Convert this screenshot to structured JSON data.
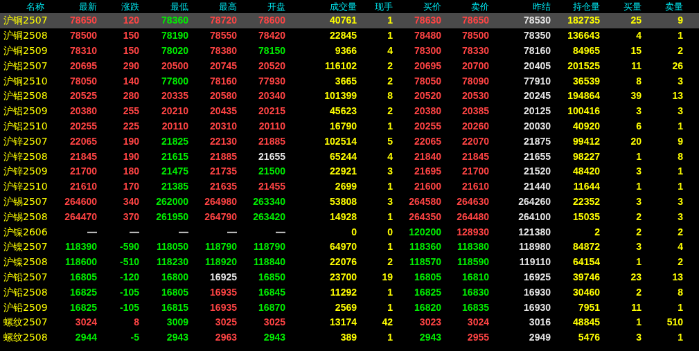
{
  "columns": [
    {
      "label": "名称",
      "kind": "name"
    },
    {
      "label": "最新",
      "kind": "price"
    },
    {
      "label": "涨跌",
      "kind": "change"
    },
    {
      "label": "最低",
      "kind": "price"
    },
    {
      "label": "最高",
      "kind": "price"
    },
    {
      "label": "开盘",
      "kind": "price"
    },
    {
      "label": "成交量",
      "kind": "qty"
    },
    {
      "label": "现手",
      "kind": "qty"
    },
    {
      "label": "买价",
      "kind": "price"
    },
    {
      "label": "卖价",
      "kind": "price"
    },
    {
      "label": "昨结",
      "kind": "prev"
    },
    {
      "label": "持仓量",
      "kind": "qty"
    },
    {
      "label": "买量",
      "kind": "qty"
    },
    {
      "label": "卖量",
      "kind": "qty"
    }
  ],
  "rows": [
    {
      "selected": true,
      "cells": [
        "沪铜2507",
        "78650",
        "120",
        "78360",
        "78720",
        "78600",
        "40761",
        "1",
        "78630",
        "78650",
        "78530",
        "182735",
        "25",
        "9"
      ]
    },
    {
      "selected": false,
      "cells": [
        "沪铜2508",
        "78500",
        "150",
        "78190",
        "78550",
        "78420",
        "22845",
        "1",
        "78480",
        "78500",
        "78350",
        "136643",
        "4",
        "1"
      ]
    },
    {
      "selected": false,
      "cells": [
        "沪铜2509",
        "78310",
        "150",
        "78020",
        "78380",
        "78150",
        "9366",
        "4",
        "78300",
        "78330",
        "78160",
        "84965",
        "15",
        "2"
      ]
    },
    {
      "selected": false,
      "cells": [
        "沪铝2507",
        "20695",
        "290",
        "20500",
        "20745",
        "20520",
        "116102",
        "2",
        "20695",
        "20700",
        "20405",
        "201525",
        "11",
        "26"
      ]
    },
    {
      "selected": false,
      "cells": [
        "沪铜2510",
        "78050",
        "140",
        "77800",
        "78160",
        "77930",
        "3665",
        "2",
        "78050",
        "78090",
        "77910",
        "36539",
        "8",
        "3"
      ]
    },
    {
      "selected": false,
      "cells": [
        "沪铝2508",
        "20525",
        "280",
        "20335",
        "20580",
        "20340",
        "101399",
        "8",
        "20520",
        "20530",
        "20245",
        "194864",
        "39",
        "13"
      ]
    },
    {
      "selected": false,
      "cells": [
        "沪铝2509",
        "20380",
        "255",
        "20210",
        "20435",
        "20215",
        "45623",
        "2",
        "20380",
        "20385",
        "20125",
        "100416",
        "3",
        "3"
      ]
    },
    {
      "selected": false,
      "cells": [
        "沪铝2510",
        "20255",
        "225",
        "20110",
        "20310",
        "20110",
        "16790",
        "1",
        "20255",
        "20260",
        "20030",
        "40920",
        "6",
        "1"
      ]
    },
    {
      "selected": false,
      "cells": [
        "沪锌2507",
        "22065",
        "190",
        "21825",
        "22130",
        "21885",
        "102514",
        "5",
        "22065",
        "22070",
        "21875",
        "99412",
        "20",
        "9"
      ]
    },
    {
      "selected": false,
      "cells": [
        "沪锌2508",
        "21845",
        "190",
        "21615",
        "21885",
        "21655",
        "65244",
        "4",
        "21840",
        "21845",
        "21655",
        "98227",
        "1",
        "8"
      ]
    },
    {
      "selected": false,
      "cells": [
        "沪锌2509",
        "21700",
        "180",
        "21475",
        "21735",
        "21500",
        "22921",
        "3",
        "21695",
        "21700",
        "21520",
        "48420",
        "3",
        "1"
      ]
    },
    {
      "selected": false,
      "cells": [
        "沪锌2510",
        "21610",
        "170",
        "21385",
        "21635",
        "21455",
        "2699",
        "1",
        "21600",
        "21610",
        "21440",
        "11644",
        "1",
        "1"
      ]
    },
    {
      "selected": false,
      "cells": [
        "沪锡2507",
        "264600",
        "340",
        "262000",
        "264980",
        "263340",
        "53808",
        "3",
        "264580",
        "264630",
        "264260",
        "22352",
        "3",
        "3"
      ]
    },
    {
      "selected": false,
      "cells": [
        "沪锡2508",
        "264470",
        "370",
        "261950",
        "264790",
        "263420",
        "14928",
        "1",
        "264350",
        "264480",
        "264100",
        "15035",
        "2",
        "3"
      ]
    },
    {
      "selected": false,
      "cells": [
        "沪镍2606",
        "—",
        "—",
        "—",
        "—",
        "—",
        "0",
        "0",
        "120200",
        "128930",
        "121380",
        "2",
        "2",
        "2"
      ]
    },
    {
      "selected": false,
      "cells": [
        "沪镍2507",
        "118390",
        "-590",
        "118050",
        "118790",
        "118790",
        "64970",
        "1",
        "118360",
        "118380",
        "118980",
        "84872",
        "3",
        "4"
      ]
    },
    {
      "selected": false,
      "cells": [
        "沪镍2508",
        "118600",
        "-510",
        "118230",
        "118920",
        "118840",
        "22076",
        "2",
        "118570",
        "118590",
        "119110",
        "64154",
        "1",
        "2"
      ]
    },
    {
      "selected": false,
      "cells": [
        "沪铅2507",
        "16805",
        "-120",
        "16800",
        "16925",
        "16850",
        "23700",
        "19",
        "16805",
        "16810",
        "16925",
        "39746",
        "23",
        "13"
      ]
    },
    {
      "selected": false,
      "cells": [
        "沪铅2508",
        "16825",
        "-105",
        "16805",
        "16935",
        "16845",
        "11292",
        "1",
        "16825",
        "16830",
        "16930",
        "30460",
        "2",
        "8"
      ]
    },
    {
      "selected": false,
      "cells": [
        "沪铅2509",
        "16825",
        "-105",
        "16815",
        "16935",
        "16870",
        "2569",
        "1",
        "16820",
        "16835",
        "16930",
        "7951",
        "11",
        "1"
      ]
    },
    {
      "selected": false,
      "cells": [
        "螺纹2507",
        "3024",
        "8",
        "3009",
        "3025",
        "3025",
        "13174",
        "42",
        "3023",
        "3024",
        "3016",
        "48845",
        "1",
        "510"
      ]
    },
    {
      "selected": false,
      "cells": [
        "螺纹2508",
        "2944",
        "-5",
        "2943",
        "2963",
        "2943",
        "389",
        "1",
        "2943",
        "2955",
        "2949",
        "5476",
        "3",
        "1"
      ]
    }
  ]
}
